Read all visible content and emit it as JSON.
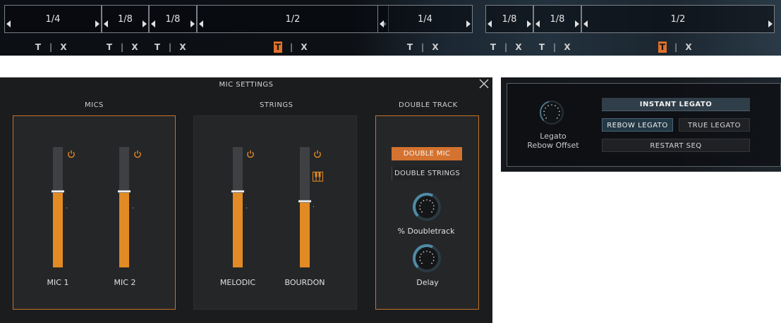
{
  "top_strip": {
    "segments": [
      {
        "value": "1/4"
      },
      {
        "value": "1/8"
      },
      {
        "value": "1/8"
      },
      {
        "value": "1/2"
      },
      {
        "value": "1/4"
      },
      {
        "value": "1/8"
      },
      {
        "value": "1/8"
      },
      {
        "value": "1/2"
      }
    ],
    "tix": [
      {
        "t": "T",
        "sep": "|",
        "x": "X",
        "t_active": false
      },
      {
        "t": "T",
        "sep": "|",
        "x": "X",
        "t_active": false
      },
      {
        "t": "T",
        "sep": "|",
        "x": "X",
        "t_active": false
      },
      {
        "t": "T",
        "sep": "|",
        "x": "X",
        "t_active": true
      },
      {
        "t": "T",
        "sep": "|",
        "x": "X",
        "t_active": false
      },
      {
        "t": "T",
        "sep": "|",
        "x": "X",
        "t_active": false
      },
      {
        "t": "T",
        "sep": "|",
        "x": "X",
        "t_active": false
      },
      {
        "t": "T",
        "sep": "|",
        "x": "X",
        "t_active": true
      }
    ],
    "accent_color": "#e0702a"
  },
  "mic_settings": {
    "title": "MIC SETTINGS",
    "close_icon": "close-icon",
    "mics": {
      "label": "MICS",
      "channels": [
        {
          "name": "MIC 1",
          "level": 0.63,
          "power_icon": "power-icon"
        },
        {
          "name": "MIC 2",
          "level": 0.63,
          "power_icon": "power-icon"
        }
      ]
    },
    "strings": {
      "label": "STRINGS",
      "channels": [
        {
          "name": "MELODIC",
          "level": 0.63,
          "power_icon": "power-icon"
        },
        {
          "name": "BOURDON",
          "level": 0.55,
          "power_icon": "power-icon",
          "extra_icon": "piano-keys-icon"
        }
      ]
    },
    "double_track": {
      "label": "DOUBLE TRACK",
      "double_mic": "DOUBLE MIC",
      "double_strings": "DOUBLE STRINGS",
      "doubletrack_label": "% Doubletrack",
      "doubletrack_value": 0.6,
      "delay_label": "Delay",
      "delay_value": 0.6
    },
    "colors": {
      "fader_fill": "#e28a23",
      "panel_border": "#c2742b",
      "knob_arc": "#4f8aa6"
    }
  },
  "legato": {
    "instant_legato": "INSTANT LEGATO",
    "rebow_legato": "REBOW LEGATO",
    "true_legato": "TRUE LEGATO",
    "restart_seq": "RESTART SEQ",
    "knob_label_line1": "Legato",
    "knob_label_line2": "Rebow Offset",
    "knob_value": 0.45
  }
}
